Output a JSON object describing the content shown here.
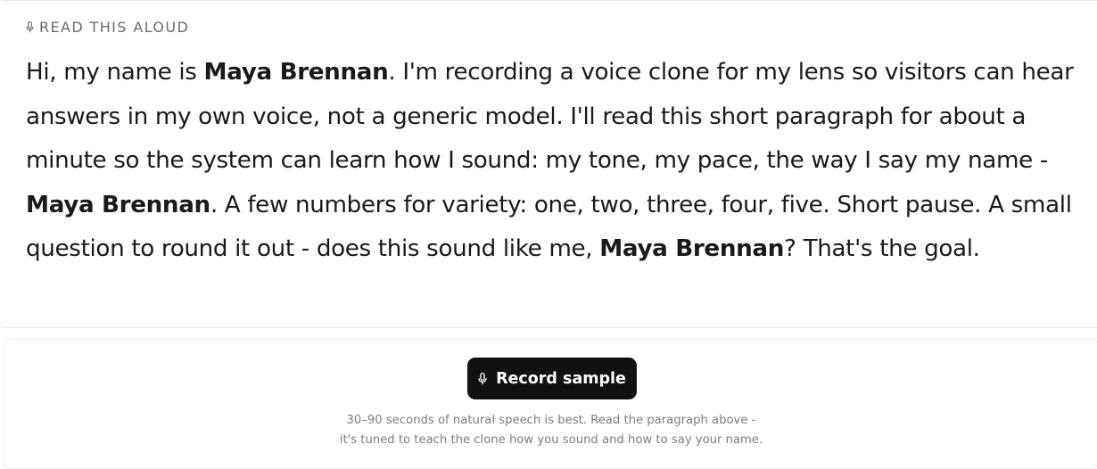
{
  "prompt": {
    "label": "READ THIS ALOUD",
    "label_icon": "microphone-icon",
    "script": [
      {
        "text": "Hi, my name is ",
        "bold": false
      },
      {
        "text": "Maya Brennan",
        "bold": true
      },
      {
        "text": ". I'm recording a voice clone for my lens so visitors can hear answers in my own voice, not a generic model. I'll read this short paragraph for about a minute so the system can learn how I sound: my tone, my pace, the way I say my name - ",
        "bold": false
      },
      {
        "text": "Maya Brennan",
        "bold": true
      },
      {
        "text": ". A few numbers for variety: one, two, three, four, five. Short pause. A small question to round it out - does this sound like me, ",
        "bold": false
      },
      {
        "text": "Maya Brennan",
        "bold": true
      },
      {
        "text": "? That's the goal.",
        "bold": false
      }
    ]
  },
  "recorder": {
    "button_label": "Record sample",
    "button_icon": "microphone-icon",
    "hint_line1": "30–90 seconds of natural speech is best. Read the paragraph above -",
    "hint_line2": "it's tuned to teach the clone how you sound and how to say your name."
  },
  "colors": {
    "button_bg": "#111111",
    "text": "#1a1a1a",
    "muted": "#6b6b6b"
  }
}
